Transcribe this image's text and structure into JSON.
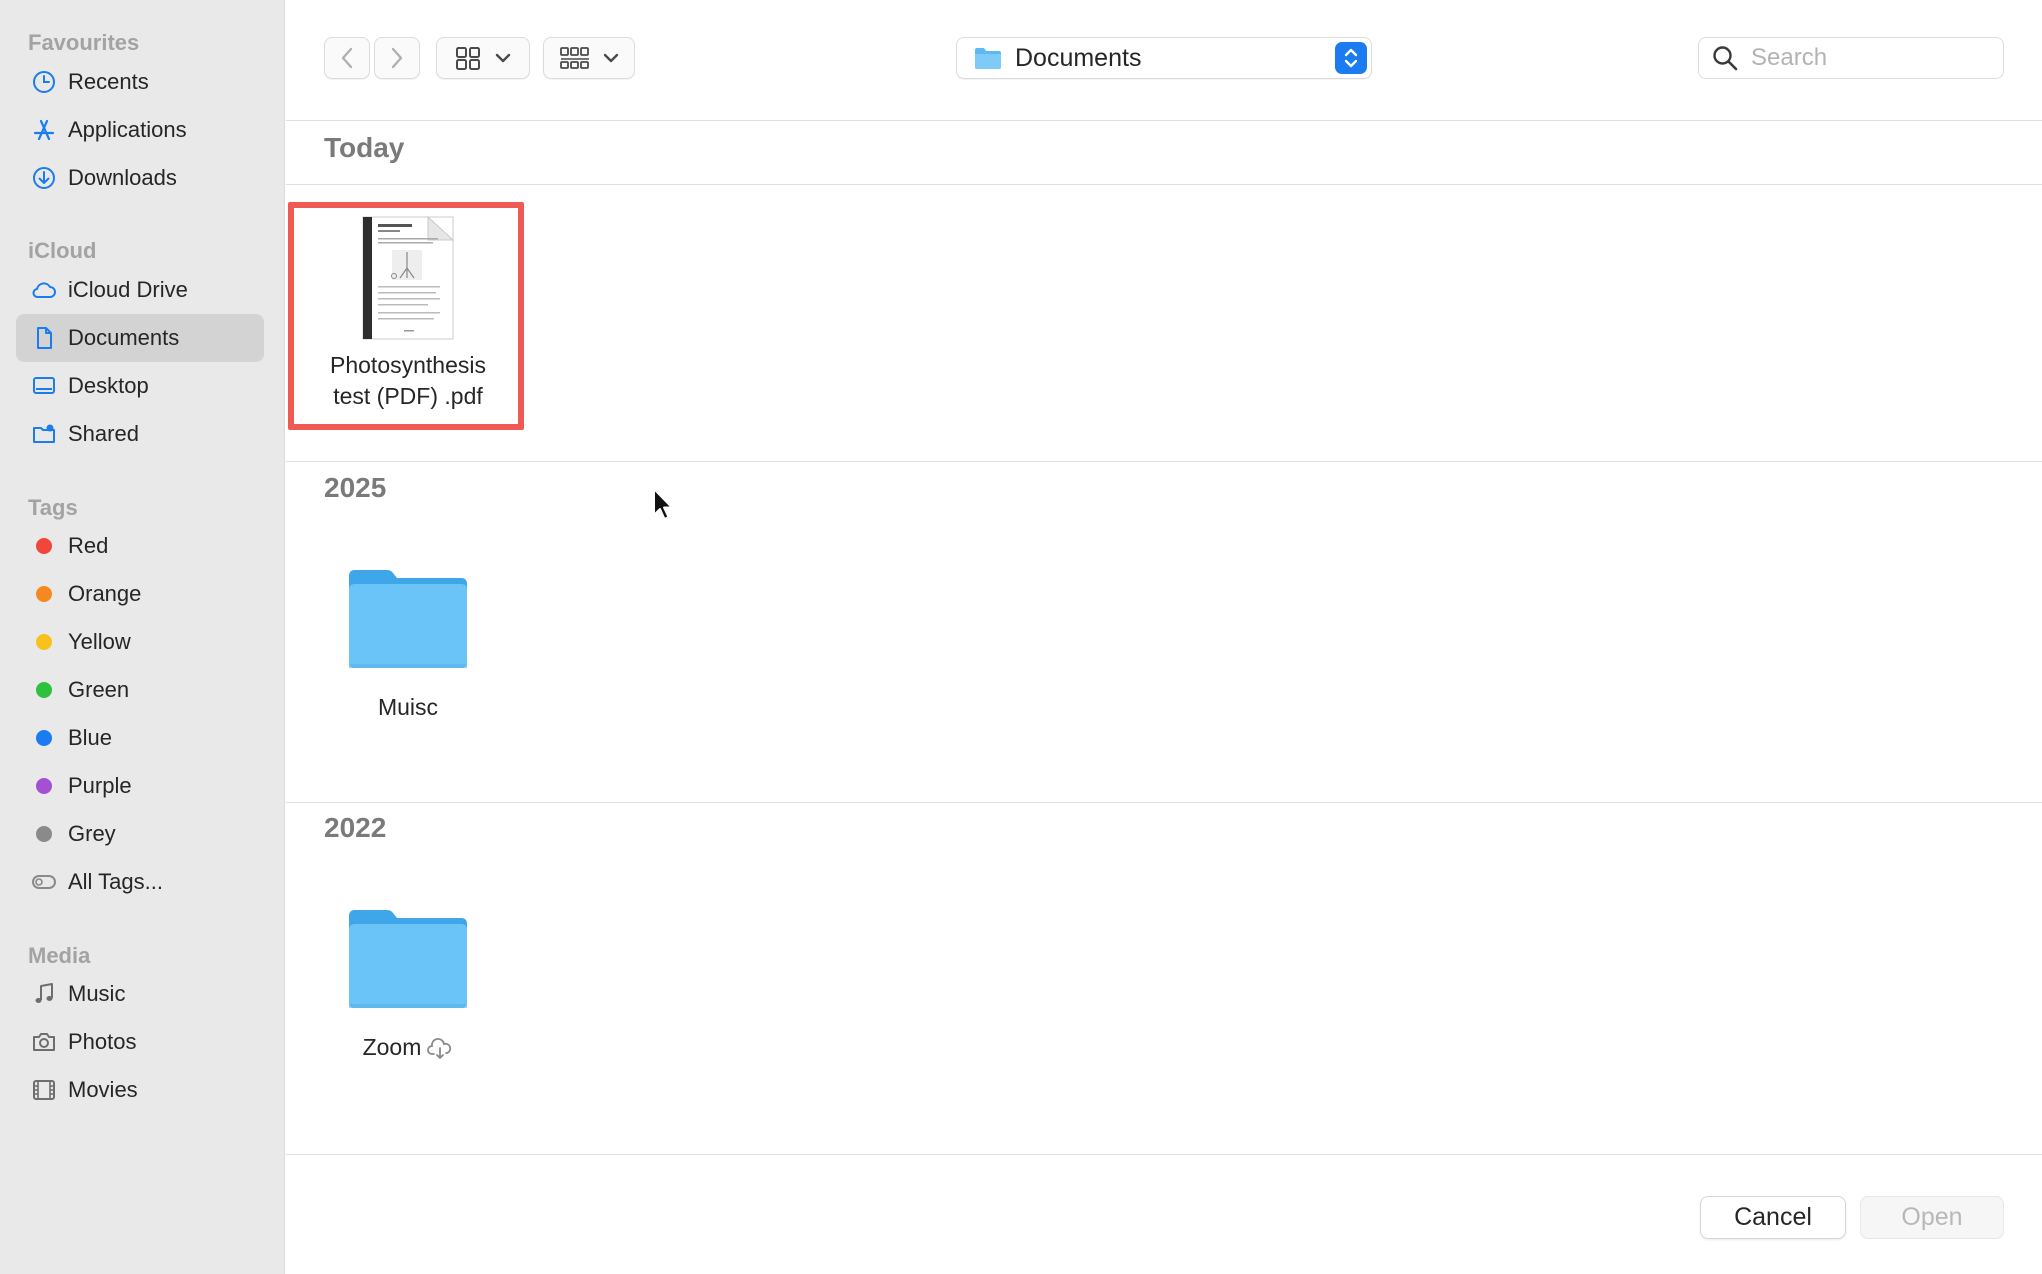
{
  "sidebar": {
    "sections": {
      "favourites": "Favourites",
      "icloud": "iCloud",
      "tags": "Tags",
      "media": "Media"
    },
    "favourites": [
      {
        "label": "Recents",
        "icon": "clock-icon"
      },
      {
        "label": "Applications",
        "icon": "applications-icon"
      },
      {
        "label": "Downloads",
        "icon": "download-icon"
      }
    ],
    "icloud": [
      {
        "label": "iCloud Drive",
        "icon": "cloud-icon"
      },
      {
        "label": "Documents",
        "icon": "document-icon",
        "selected": true
      },
      {
        "label": "Desktop",
        "icon": "desktop-icon"
      },
      {
        "label": "Shared",
        "icon": "shared-folder-icon"
      }
    ],
    "tags": [
      {
        "label": "Red",
        "color": "#f2463d"
      },
      {
        "label": "Orange",
        "color": "#f5891f"
      },
      {
        "label": "Yellow",
        "color": "#f7c21c"
      },
      {
        "label": "Green",
        "color": "#2fc03f"
      },
      {
        "label": "Blue",
        "color": "#1b7cf2"
      },
      {
        "label": "Purple",
        "color": "#a550d4"
      },
      {
        "label": "Grey",
        "color": "#8a8a8a"
      },
      {
        "label": "All Tags...",
        "icon": "all-tags-icon"
      }
    ],
    "media": [
      {
        "label": "Music",
        "icon": "music-note-icon"
      },
      {
        "label": "Photos",
        "icon": "camera-icon"
      },
      {
        "label": "Movies",
        "icon": "film-icon"
      }
    ]
  },
  "toolbar": {
    "location": "Documents",
    "search_placeholder": "Search"
  },
  "groups": [
    {
      "header": "Today",
      "items": [
        {
          "name": "Photosynthesis test (PDF) .pdf",
          "line1": "Photosynthesis",
          "line2": "test (PDF) .pdf",
          "type": "pdf",
          "highlighted": true
        }
      ]
    },
    {
      "header": "2025",
      "items": [
        {
          "name": "Muisc",
          "type": "folder"
        }
      ]
    },
    {
      "header": "2022",
      "items": [
        {
          "name": "Zoom",
          "type": "folder",
          "cloud": true
        }
      ]
    }
  ],
  "buttons": {
    "cancel": "Cancel",
    "open": "Open"
  },
  "colors": {
    "accent": "#1a7cf0",
    "folder": "#6ac4f7",
    "highlight": "#f05a55"
  }
}
